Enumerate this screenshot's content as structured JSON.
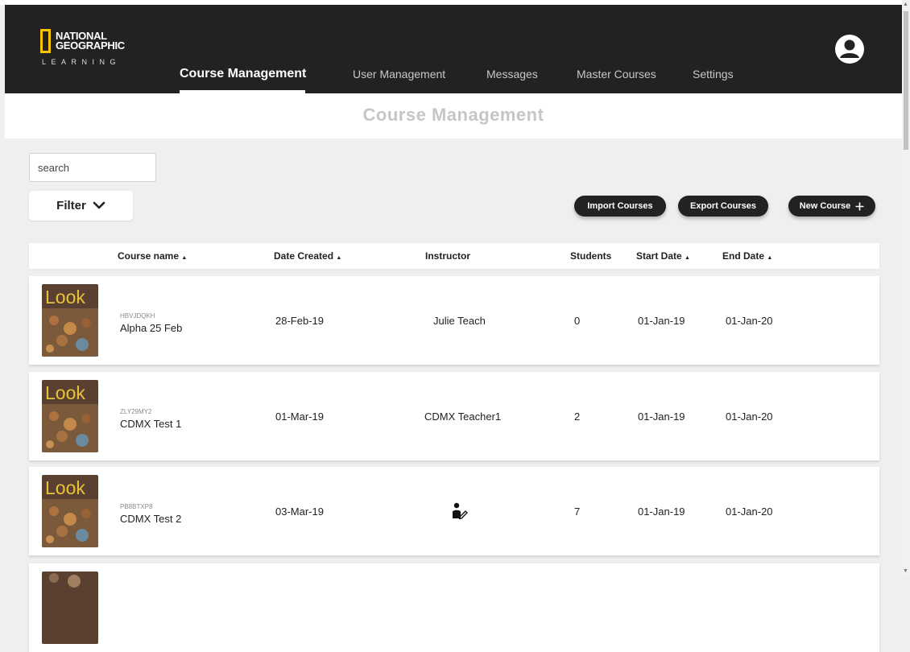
{
  "brand": {
    "line1": "NATIONAL",
    "line2": "GEOGRAPHIC",
    "line3": "LEARNING",
    "accent": "#f6c400"
  },
  "nav": {
    "items": [
      {
        "label": "Course Management",
        "active": true
      },
      {
        "label": "User Management",
        "active": false
      },
      {
        "label": "Messages",
        "active": false
      },
      {
        "label": "Master Courses",
        "active": false
      },
      {
        "label": "Settings",
        "active": false
      }
    ],
    "avatar_icon": "user-circle-icon"
  },
  "page": {
    "title": "Course Management"
  },
  "toolbar": {
    "search_placeholder": "search",
    "filter_label": "Filter",
    "filter_icon": "chevron-down-icon",
    "import_label": "Import Courses",
    "export_label": "Export Courses",
    "new_label": "New Course",
    "new_icon": "plus-icon"
  },
  "table": {
    "columns": [
      "Course name",
      "Date Created",
      "Instructor",
      "Students",
      "Start Date",
      "End Date"
    ],
    "sortable_marker": "▲",
    "rows": [
      {
        "cover_word": "Look",
        "code": "HBVJDQKH",
        "name": "Alpha 25 Feb",
        "created": "28-Feb-19",
        "instructor": "Julie Teach",
        "students": "0",
        "start": "01-Jan-19",
        "end": "01-Jan-20"
      },
      {
        "cover_word": "Look",
        "code": "ZLY29MY2",
        "name": "CDMX Test 1",
        "created": "01-Mar-19",
        "instructor": "CDMX Teacher1",
        "students": "2",
        "start": "01-Jan-19",
        "end": "01-Jan-20"
      },
      {
        "cover_word": "Look",
        "code": "PB8BTXP8",
        "name": "CDMX Test 2",
        "created": "03-Mar-19",
        "instructor": "",
        "instructor_icon": "assign-teacher-icon",
        "students": "7",
        "start": "01-Jan-19",
        "end": "01-Jan-20"
      }
    ]
  },
  "colors": {
    "header_bg": "#222222",
    "pill_bg": "#222222",
    "page_bg": "#efefef"
  }
}
